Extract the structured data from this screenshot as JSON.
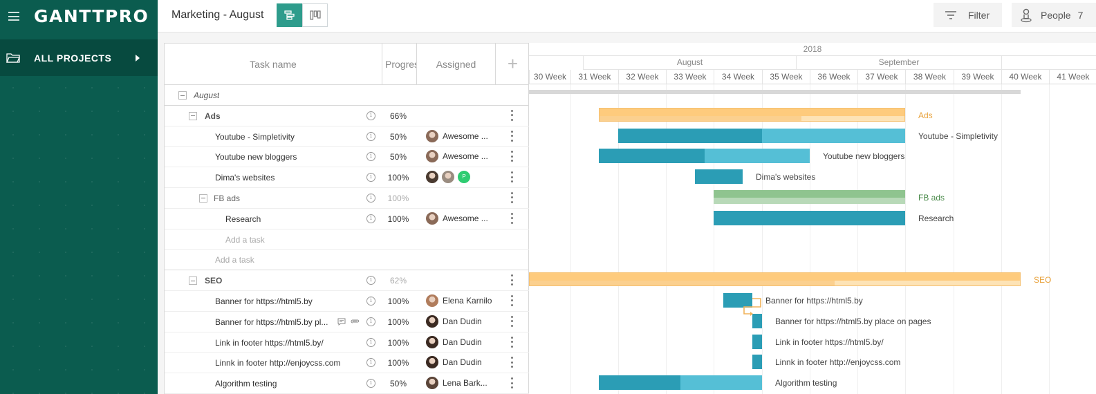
{
  "app": {
    "logo": "GANTTPRO"
  },
  "sidebar": {
    "all_projects": "ALL PROJECTS"
  },
  "header": {
    "project_title": "Marketing - August",
    "filter_label": "Filter",
    "people_label": "People",
    "people_count": "7"
  },
  "grid": {
    "columns": {
      "task_name": "Task name",
      "progress": "Progress",
      "assigned": "Assigned",
      "add": "+"
    },
    "rows": [
      {
        "name": "August",
        "progress": "",
        "assignee": ""
      },
      {
        "name": "Ads",
        "progress": "66%",
        "assignee": ""
      },
      {
        "name": "Youtube - Simpletivity",
        "progress": "50%",
        "assignee": "Awesome ..."
      },
      {
        "name": "Youtube new bloggers",
        "progress": "50%",
        "assignee": "Awesome ..."
      },
      {
        "name": "Dima's websites",
        "progress": "100%",
        "assignee": "",
        "extra_avatar": "P"
      },
      {
        "name": "FB ads",
        "progress": "100%",
        "assignee": ""
      },
      {
        "name": "Research",
        "progress": "100%",
        "assignee": "Awesome ..."
      },
      {
        "name": "Add a task",
        "progress": "",
        "assignee": ""
      },
      {
        "name": "Add a task",
        "progress": "",
        "assignee": ""
      },
      {
        "name": "SEO",
        "progress": "62%",
        "assignee": ""
      },
      {
        "name": "Banner for https://html5.by",
        "progress": "100%",
        "assignee": "Elena Karnilo"
      },
      {
        "name": "Banner for https://html5.by pl...",
        "progress": "100%",
        "assignee": "Dan Dudin"
      },
      {
        "name": "Link in footer https://html5.by/",
        "progress": "100%",
        "assignee": "Dan Dudin"
      },
      {
        "name": "Linnk in footer http://enjoycss.com",
        "progress": "100%",
        "assignee": "Dan Dudin"
      },
      {
        "name": "Algorithm testing",
        "progress": "50%",
        "assignee": "Lena Bark..."
      }
    ]
  },
  "timeline": {
    "year": "2018",
    "months": [
      "August",
      "September"
    ],
    "weeks": [
      "30 Week",
      "31 Week",
      "32 Week",
      "33 Week",
      "34 Week",
      "35 Week",
      "36 Week",
      "37 Week",
      "38 Week",
      "39 Week",
      "40 Week",
      "41 Week"
    ],
    "labels": {
      "ads": "Ads",
      "yt_simpletivity": "Youtube - Simpletivity",
      "yt_bloggers": "Youtube new bloggers",
      "dima": "Dima's websites",
      "fb": "FB ads",
      "research": "Research",
      "seo": "SEO",
      "banner1": "Banner for https://html5.by",
      "banner2": "Banner for https://html5.by place on pages",
      "link1": "Link in footer https://html5.by/",
      "link2": "Linnk in footer http://enjoycss.com",
      "algo": "Algorithm testing"
    }
  },
  "colors": {
    "sidebar": "#0b5c4f",
    "accent": "#2e9c8c",
    "task_bar": "#2b9db5",
    "task_bar_light": "#55bfd6",
    "group_orange": "#fecb7d",
    "group_green": "#8fc48f",
    "label_orange": "#e8a23c"
  }
}
